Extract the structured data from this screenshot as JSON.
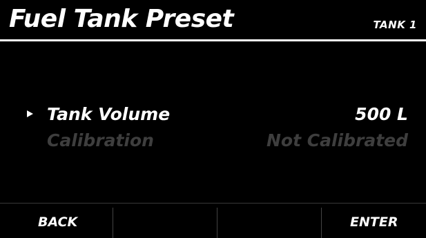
{
  "header": {
    "title": "Fuel Tank Preset",
    "tank": "TANK 1"
  },
  "menu": {
    "items": [
      {
        "label": "Tank Volume",
        "value": "500 L",
        "selected": true
      },
      {
        "label": "Calibration",
        "value": "Not Calibrated",
        "selected": false
      }
    ]
  },
  "softkeys": {
    "back": "BACK",
    "key2": "",
    "key3": "",
    "enter": "ENTER"
  },
  "colors": {
    "background": "#000000",
    "text": "#ffffff",
    "dimmed_text": "#3e3e3e"
  },
  "icons": {
    "cursor": "selection-arrow-icon"
  }
}
